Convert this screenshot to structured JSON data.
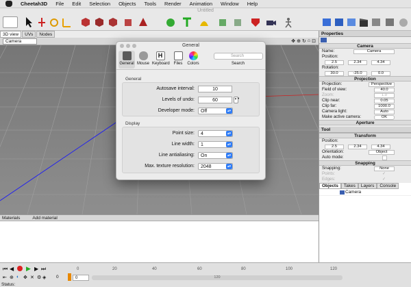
{
  "menubar": {
    "app": "Cheetah3D",
    "items": [
      "File",
      "Edit",
      "Selection",
      "Objects",
      "Tools",
      "Render",
      "Animation",
      "Window",
      "Help"
    ]
  },
  "window": {
    "title": "Untitled"
  },
  "view_tabs": [
    "3D view",
    "UVs",
    "Nodes"
  ],
  "viewport": {
    "camera_select": "Camera"
  },
  "dialog": {
    "title": "General",
    "panes": [
      {
        "label": "General",
        "icon": "general-pane-icon",
        "color": "#5a5a5a"
      },
      {
        "label": "Mouse",
        "icon": "mouse-icon",
        "color": "#9a9a9a"
      },
      {
        "label": "Keyboard",
        "icon": "keyboard-icon",
        "color": "#777777"
      },
      {
        "label": "Files",
        "icon": "files-icon",
        "color": "#666666"
      },
      {
        "label": "Colors",
        "icon": "color-wheel-icon",
        "color": "#e04a8a"
      }
    ],
    "search_placeholder": "Search",
    "search_label": "Search",
    "general_group": "General",
    "display_group": "Display",
    "general_rows": [
      {
        "label": "Autosave interval:",
        "value": "10",
        "kind": "text"
      },
      {
        "label": "Levels of undo:",
        "value": "60",
        "kind": "stepper"
      },
      {
        "label": "Developer mode:",
        "value": "Off",
        "kind": "popup"
      }
    ],
    "display_rows": [
      {
        "label": "Point size:",
        "value": "4",
        "kind": "popup"
      },
      {
        "label": "Line width:",
        "value": "1",
        "kind": "popup"
      },
      {
        "label": "Line antialiasing:",
        "value": "On",
        "kind": "popup"
      },
      {
        "label": "Max. texture resolution:",
        "value": "2048",
        "kind": "popup"
      }
    ]
  },
  "properties": {
    "title": "Properties",
    "camera_section": "Camera",
    "name_label": "Name:",
    "name_value": "Camera",
    "position_label": "Position:",
    "position": [
      "2.5",
      "2.34",
      "4.34"
    ],
    "rotation_label": "Rotation:",
    "rotation": [
      "30.0",
      "-25.0",
      "0.0"
    ],
    "projection_section": "Projection",
    "fields": [
      {
        "label": "Projection:",
        "value": "Perspective"
      },
      {
        "label": "Field of view:",
        "value": "40.0"
      },
      {
        "label": "Zoom:",
        "value": "1.0"
      },
      {
        "label": "Clip near:",
        "value": "0.05"
      },
      {
        "label": "Clip far:",
        "value": "1000.0"
      },
      {
        "label": "Camera light:",
        "value": "Auto"
      },
      {
        "label": "Make active camera:",
        "value": "OK"
      }
    ],
    "aperture_section": "Aperture"
  },
  "tool": {
    "title": "Tool",
    "transform_section": "Transform",
    "position_label": "Position:",
    "position": [
      "2.5",
      "2.34",
      "4.34"
    ],
    "orientation_label": "Orientation:",
    "orientation_value": "Object",
    "automode_label": "Auto mode:",
    "snapping_section": "Snapping",
    "snapping_label": "Snapping:",
    "snapping_value": "None",
    "points_label": "Points:",
    "edges_label": "Edges:"
  },
  "objects": {
    "tabs": [
      "Objects",
      "Takes",
      "Layers",
      "Console"
    ],
    "items": [
      "Camera"
    ]
  },
  "materials": {
    "title": "Materials",
    "add": "Add material"
  },
  "timeline": {
    "ticks": [
      "0",
      "20",
      "40",
      "60",
      "80",
      "100",
      "120"
    ],
    "frame": "0",
    "frame_field": "0",
    "scroll_label": "120",
    "status": "Status:"
  }
}
